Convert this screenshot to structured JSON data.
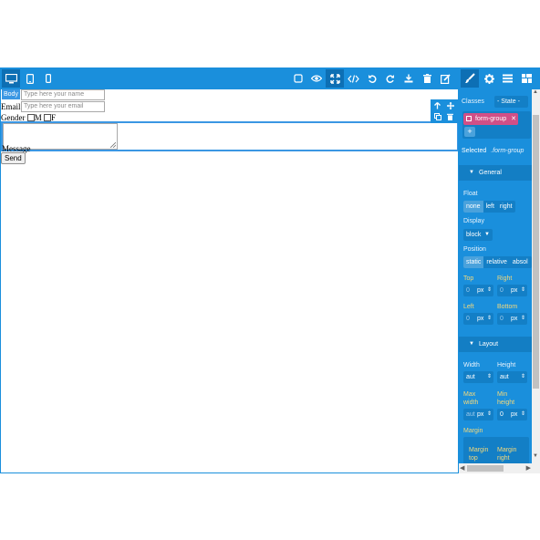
{
  "toolbar": {
    "devices": [
      "desktop-icon",
      "tablet-icon",
      "mobile-icon"
    ],
    "actions": [
      "sw-visibility-icon",
      "preview-icon",
      "fullscreen-icon",
      "code-icon",
      "undo-icon",
      "redo-icon",
      "import-icon",
      "clear-icon",
      "edit-icon"
    ],
    "panels": [
      "style-manager-icon",
      "settings-icon",
      "layers-icon",
      "blocks-icon"
    ]
  },
  "canvas": {
    "badge": "Body",
    "name_placeholder": "Type here your name",
    "email_label": "Email",
    "email_placeholder": "Type here your email",
    "gender_label": "Gender",
    "gender_m": "M",
    "gender_f": "F",
    "message_label": "Message",
    "send_label": "Send"
  },
  "panel": {
    "classes_label": "Classes",
    "state_label": "- State -",
    "tag_label": "form-group",
    "add_label": "+",
    "selected_prefix": "Selected",
    "selected_value": ".form-group",
    "general": {
      "title": "General",
      "float_label": "Float",
      "float_options": [
        "none",
        "left",
        "right"
      ],
      "display_label": "Display",
      "display_value": "block",
      "position_label": "Position",
      "position_options": [
        "static",
        "relative",
        "absol"
      ],
      "top_label": "Top",
      "right_label": "Right",
      "left_label": "Left",
      "bottom_label": "Bottom",
      "zero": "0",
      "unit": "px"
    },
    "layout": {
      "title": "Layout",
      "width_label": "Width",
      "height_label": "Height",
      "width_value": "aut",
      "height_value": "aut",
      "max_width_label": "Max width",
      "min_height_label": "Min height",
      "max_width_value": "aut",
      "min_height_value": "0",
      "unit": "px",
      "margin_label": "Margin",
      "margin_top_label": "Margin top",
      "margin_right_label": "Margin right"
    }
  },
  "colors": {
    "toolbar": "#1a8fdc",
    "accent_tag": "#d14f87",
    "highlight": "#3b97e3"
  }
}
